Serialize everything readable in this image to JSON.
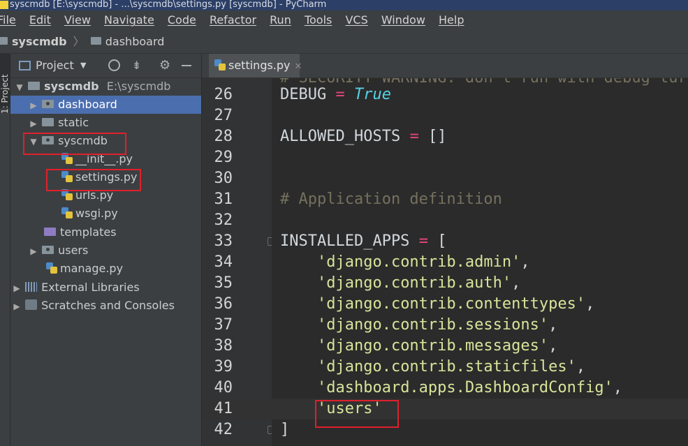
{
  "window": {
    "title": "syscmdb [E:\\syscmdb] - ...\\syscmdb\\settings.py [syscmdb] - PyCharm"
  },
  "menu": [
    "File",
    "Edit",
    "View",
    "Navigate",
    "Code",
    "Refactor",
    "Run",
    "Tools",
    "VCS",
    "Window",
    "Help"
  ],
  "breadcrumb": {
    "root": "syscmdb",
    "child": "dashboard"
  },
  "tool_stripe": {
    "label": "1: Project"
  },
  "project_panel": {
    "title": "Project",
    "tree": [
      {
        "label": "syscmdb",
        "path": "E:\\syscmdb"
      },
      {
        "label": "dashboard"
      },
      {
        "label": "static"
      },
      {
        "label": "syscmdb"
      },
      {
        "label": "__init__.py"
      },
      {
        "label": "settings.py"
      },
      {
        "label": "urls.py"
      },
      {
        "label": "wsgi.py"
      },
      {
        "label": "templates"
      },
      {
        "label": "users"
      },
      {
        "label": "manage.py"
      },
      {
        "label": "External Libraries"
      },
      {
        "label": "Scratches and Consoles"
      }
    ]
  },
  "editor": {
    "tab": "settings.py",
    "line_numbers": [
      "26",
      "27",
      "28",
      "29",
      "30",
      "31",
      "32",
      "33",
      "34",
      "35",
      "36",
      "37",
      "38",
      "39",
      "40",
      "41",
      "42"
    ],
    "partial_comment": "# SECURITY WARNING: don't run with debug turned on in production!",
    "code": {
      "debug_name": "DEBUG",
      "eq": "=",
      "true_kw": "True",
      "allowed_hosts": "ALLOWED_HOSTS",
      "empty_list": "[]",
      "comment_app": "# Application definition",
      "installed_apps": "INSTALLED_APPS",
      "open_bracket": "[",
      "close_bracket": "]",
      "apps": [
        "'django.contrib.admin'",
        "'django.contrib.auth'",
        "'django.contrib.contenttypes'",
        "'django.contrib.sessions'",
        "'django.contrib.messages'",
        "'django.contrib.staticfiles'",
        "'dashboard.apps.DashboardConfig'",
        "'users'"
      ],
      "comma": ","
    }
  },
  "colors": {
    "highlight_box": "#e0202c",
    "selection": "#4b6eaf",
    "string": "#d7e49a",
    "operator": "#e8467c",
    "keyword": "#56d3e6"
  }
}
